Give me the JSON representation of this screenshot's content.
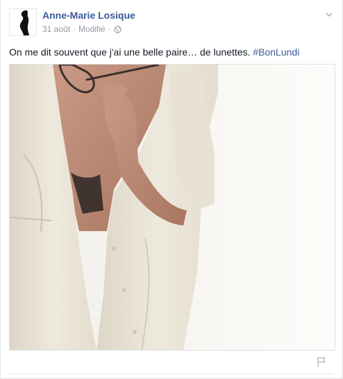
{
  "post": {
    "author": "Anne-Marie Losique",
    "date": "31 août",
    "separator": "·",
    "edited": "Modifié",
    "message_text": "On me dit souvent que j'ai une belle paire… de lunettes. ",
    "hashtag": "#BonLundi"
  },
  "icons": {
    "privacy": "globe-icon",
    "options": "chevron-down-icon",
    "report": "flag-icon"
  },
  "colors": {
    "link": "#3b5998",
    "meta": "#9197a3"
  }
}
